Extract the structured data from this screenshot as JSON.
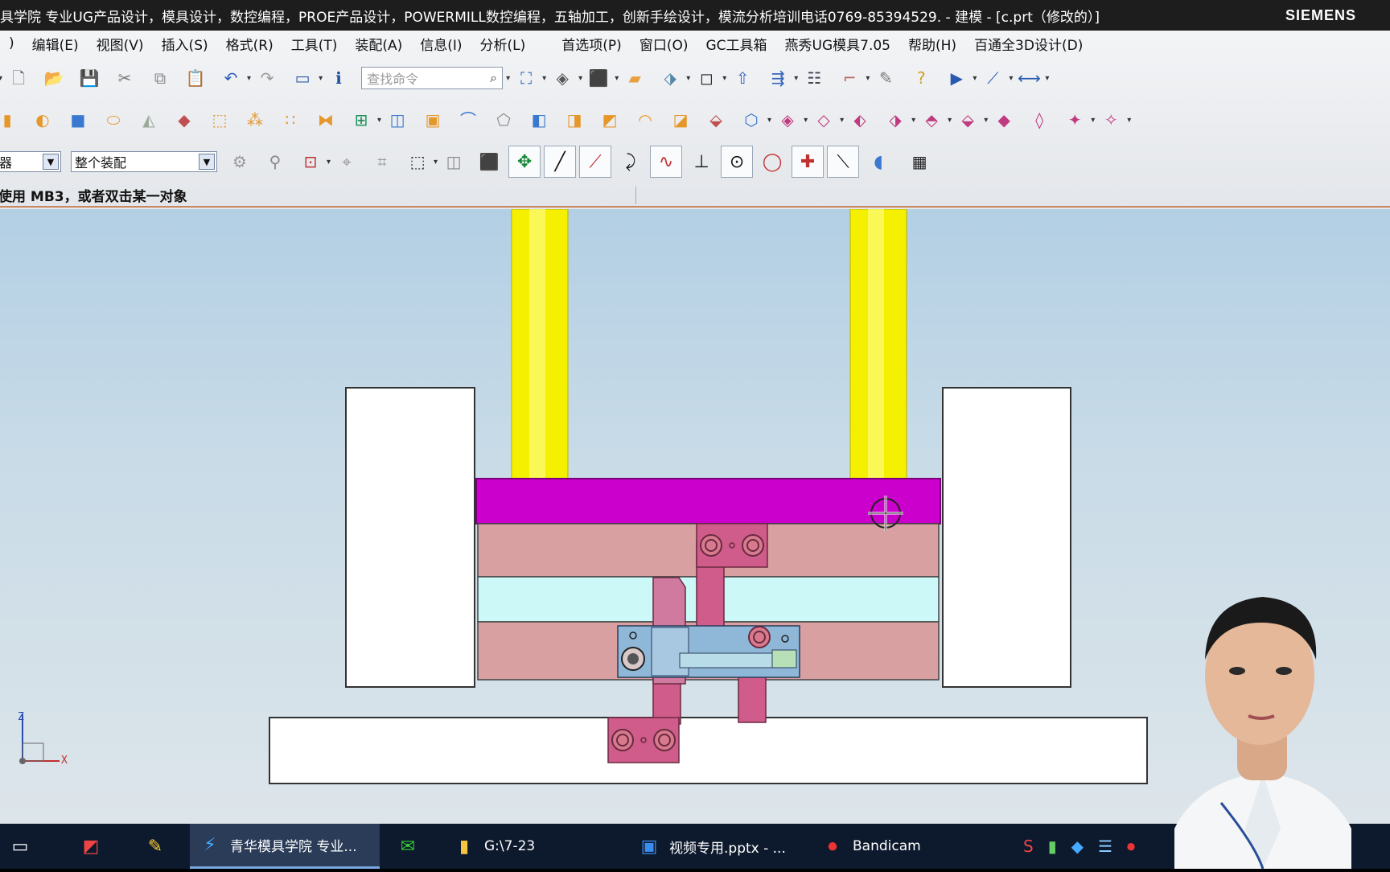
{
  "titlebar": {
    "title": "具学院 专业UG产品设计，模具设计，数控编程，PROE产品设计，POWERMILL数控编程，五轴加工，创新手绘设计，模流分析培训电话0769-85394529. - 建模 - [c.prt（修改的）]",
    "brand": "SIEMENS"
  },
  "menubar": {
    "items": [
      ")",
      "编辑(E)",
      "视图(V)",
      "插入(S)",
      "格式(R)",
      "工具(T)",
      "装配(A)",
      "信息(I)",
      "分析(L)",
      "首选项(P)",
      "窗口(O)",
      "GC工具箱",
      "燕秀UG模具7.05",
      "帮助(H)",
      "百通全3D设计(D)"
    ]
  },
  "toolbar": {
    "search_placeholder": "查找命令",
    "filter_value": "器",
    "scope_value": "整个装配"
  },
  "status": {
    "message": "使用 MB3，或者双击某一对象"
  },
  "viewport": {
    "axis_z": "Z",
    "axis_x": "X",
    "colors": {
      "background_top": "#b3cfe4",
      "background_bottom": "#dde5ea",
      "pillar": "#f5f000",
      "top_plate": "#cc00cc",
      "plates": "#d8a0a0",
      "cavity": "#ccf8f8",
      "slider": "#cf5c8a",
      "block": "#8fb8d8",
      "side_walls": "#ffffff"
    }
  },
  "taskbar": {
    "items": [
      {
        "label": "",
        "icon": "desktop-icon"
      },
      {
        "label": "",
        "icon": "app-icon"
      },
      {
        "label": "",
        "icon": "pen-icon"
      },
      {
        "label": "青华模具学院 专业...",
        "icon": "ug-nx-icon"
      },
      {
        "label": "",
        "icon": "wechat-icon"
      },
      {
        "label": "G:\\7-23",
        "icon": "folder-icon"
      },
      {
        "label": "视频专用.pptx - ...",
        "icon": "ppt-icon"
      },
      {
        "label": "Bandicam",
        "icon": "record-icon"
      }
    ]
  }
}
